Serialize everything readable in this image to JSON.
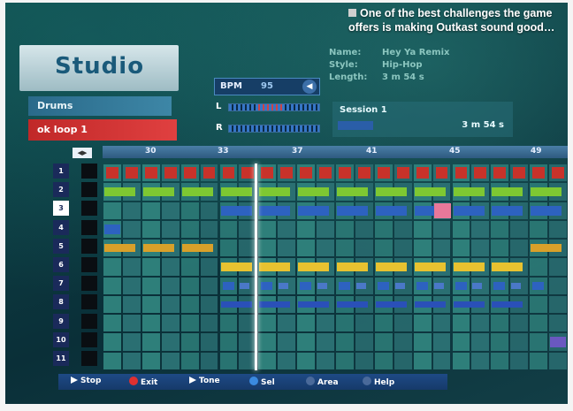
{
  "caption": "One of the best challenges the game offers is making Outkast sound good…",
  "studio": {
    "title": "Studio",
    "menu": [
      {
        "label": "Drums"
      },
      {
        "label": "ok loop 1"
      }
    ]
  },
  "bpm": {
    "label": "BPM",
    "value": "95"
  },
  "meters": [
    {
      "label": "L"
    },
    {
      "label": "R"
    }
  ],
  "info": [
    {
      "key": "Name:",
      "value": "Hey Ya Remix"
    },
    {
      "key": "Style:",
      "value": "Hip-Hop"
    },
    {
      "key": "Length:",
      "value": "3 m 54 s"
    }
  ],
  "session": {
    "title": "Session 1",
    "time": "3 m 54 s"
  },
  "ruler": {
    "scroll_label": "◀▶",
    "markers": [
      "30",
      "33",
      "37",
      "41",
      "45",
      "49"
    ]
  },
  "tracks": [
    "1",
    "2",
    "3",
    "4",
    "5",
    "6",
    "7",
    "8",
    "9",
    "10",
    "11"
  ],
  "selected_track": "3",
  "colors": {
    "red_row": "#c8322a",
    "green_row": "#7ec832",
    "blue_row": "#2d62c0",
    "orange_row": "#d8a02a",
    "yellow_row": "#e8c230",
    "navy_row": "#2a50b8",
    "purple_cell": "#6a58c0",
    "grid_empty": "#2e7f7a"
  },
  "controls": [
    {
      "icon": "triangle",
      "label": "Stop"
    },
    {
      "icon": "circle-red",
      "label": "Exit"
    },
    {
      "icon": "arrow",
      "label": "Tone"
    },
    {
      "icon": "circle-blue",
      "label": "Sel"
    },
    {
      "icon": "x",
      "label": "Area"
    },
    {
      "icon": "dot",
      "label": "Help"
    }
  ]
}
